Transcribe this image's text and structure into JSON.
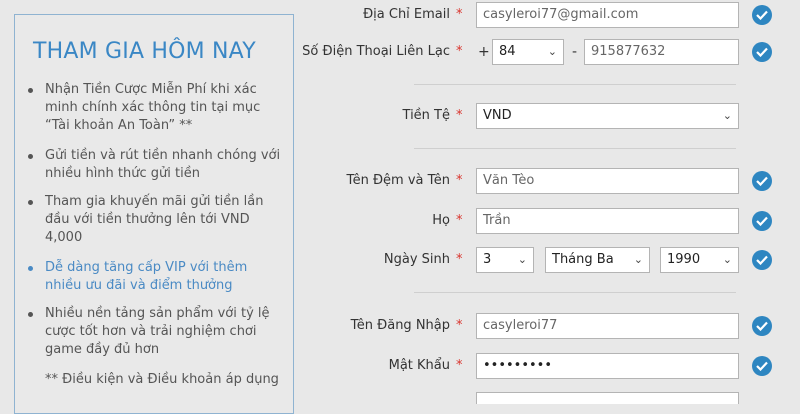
{
  "promo": {
    "title": "THAM GIA HÔM NAY",
    "items": [
      "Nhận Tiền Cược Miễn Phí khi xác minh chính xác thông tin tại mục “Tài khoản An Toàn” **",
      "Gửi tiền và rút tiền nhanh chóng với nhiều hình thức gửi tiền",
      "Tham gia khuyến mãi gửi tiền lần đầu với tiền thưởng lên tới VND 4,000",
      "Dễ dàng tăng cấp VIP với thêm nhiều ưu đãi và điểm thưởng",
      "Nhiều nền tảng sản phẩm với tỷ lệ cược tốt hơn và trải nghiệm chơi game đầy đủ hơn"
    ],
    "footnote": "** Điều kiện và Điều khoản áp dụng"
  },
  "form": {
    "required_mark": "*",
    "email": {
      "label": "Địa Chỉ Email",
      "value": "casyleroi77@gmail.com"
    },
    "phone": {
      "label": "Số Điện Thoại Liên Lạc",
      "plus": "+",
      "code": "84",
      "dash": "-",
      "value": "915877632"
    },
    "currency": {
      "label": "Tiền Tệ",
      "value": "VND"
    },
    "name": {
      "label": "Tên Đệm và Tên",
      "value": "Văn Tèo"
    },
    "surname": {
      "label": "Họ",
      "value": "Trần"
    },
    "dob": {
      "label": "Ngày Sinh",
      "day": "3",
      "month": "Tháng Ba",
      "year": "1990"
    },
    "username": {
      "label": "Tên Đăng Nhập",
      "value": "casyleroi77"
    },
    "password": {
      "label": "Mật Khẩu",
      "value": "•••••••••"
    }
  },
  "colors": {
    "accent": "#2e86c1",
    "required": "#d9322b",
    "promo_title": "#3a87c5"
  }
}
